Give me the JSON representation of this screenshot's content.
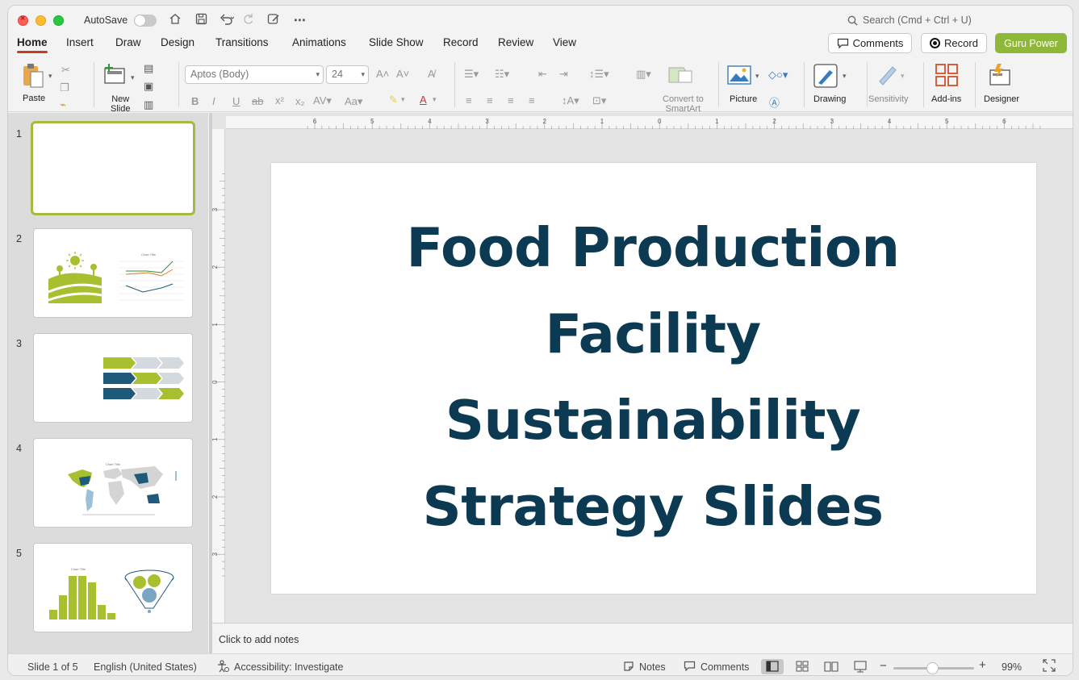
{
  "titlebar": {
    "autosave_label": "AutoSave",
    "search_placeholder": "Search (Cmd + Ctrl + U)"
  },
  "tabs": [
    {
      "label": "Home",
      "active": true
    },
    {
      "label": "Insert"
    },
    {
      "label": "Draw"
    },
    {
      "label": "Design"
    },
    {
      "label": "Transitions"
    },
    {
      "label": "Animations"
    },
    {
      "label": "Slide Show"
    },
    {
      "label": "Record"
    },
    {
      "label": "Review"
    },
    {
      "label": "View"
    }
  ],
  "header_buttons": {
    "comments": "Comments",
    "record": "Record",
    "guru": "Guru Power"
  },
  "ribbon": {
    "paste": "Paste",
    "new_slide_1": "New",
    "new_slide_2": "Slide",
    "font_name": "Aptos (Body)",
    "font_size": "24",
    "convert_1": "Convert to",
    "convert_2": "SmartArt",
    "picture": "Picture",
    "drawing": "Drawing",
    "sensitivity": "Sensitivity",
    "addins": "Add-ins",
    "designer": "Designer"
  },
  "thumbnails": [
    {
      "num": "1"
    },
    {
      "num": "2",
      "chart_title": "Chart Title"
    },
    {
      "num": "3"
    },
    {
      "num": "4",
      "chart_title": "Chart Title"
    },
    {
      "num": "5",
      "chart_title": "Chart Title"
    }
  ],
  "slide": {
    "title_lines": [
      "Food Production",
      "Facility",
      "Sustainability",
      "Strategy Slides"
    ]
  },
  "notes_placeholder": "Click to add notes",
  "status": {
    "slide_count": "Slide 1 of 5",
    "language": "English (United States)",
    "accessibility": "Accessibility: Investigate",
    "notes": "Notes",
    "comments": "Comments",
    "zoom": "99%"
  },
  "ruler": {
    "h_labels": [
      "6",
      "5",
      "4",
      "3",
      "2",
      "1",
      "0",
      "1",
      "2",
      "3",
      "4",
      "5",
      "6"
    ],
    "v_labels": [
      "3",
      "2",
      "1",
      "0",
      "1",
      "2",
      "3"
    ]
  },
  "colors": {
    "accent_green": "#8db83a",
    "title_navy": "#0b3a52",
    "tab_underline": "#c43e1c"
  }
}
